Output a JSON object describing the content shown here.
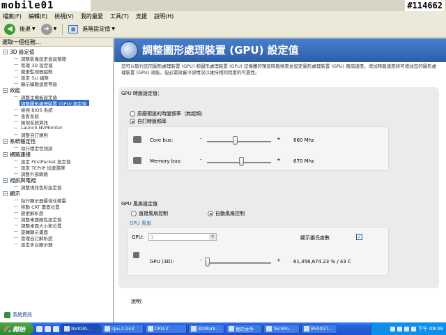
{
  "watermark": {
    "logo": "mobile01",
    "id": "#114662"
  },
  "menu": [
    "檔案(F)",
    "編輯(E)",
    "檢視(V)",
    "我的最愛",
    "工具(T)",
    "支援",
    "說明(H)"
  ],
  "toolbar": {
    "back_label": "後退",
    "forward_glyph": "➔",
    "advanced_label": "進階設定值"
  },
  "left": {
    "header": "選取一個任務...",
    "categories": [
      {
        "label": "3D 設定值",
        "items": [
          "調整影像設定值與預覽",
          "管理 3D 設定值",
          "變更監視器組態",
          "設定 SLI 組態",
          "顯示驅動速度等級"
        ]
      },
      {
        "label": "效能",
        "items": [
          "調整主機板設定值",
          "調整圖形處理裝置 (GPU) 設定值",
          "檢視 BIOS 系統",
          "查看系統",
          "檢視系統資訊",
          "Launch NVMonitor",
          "調整自訂規則"
        ]
      },
      {
        "label": "系統穩定性",
        "items": [
          "執行穩定性測試"
        ]
      },
      {
        "label": "網路連接",
        "items": [
          "設定 FirstPacket 設定值",
          "設定 TCP/IP 加速選擇",
          "調整外部網路"
        ]
      },
      {
        "label": "視訊與電視",
        "items": [
          "調整視訊色彩設定值"
        ]
      },
      {
        "label": "顯示",
        "items": [
          "執行顯示器最佳化精靈",
          "移動 CRT 畫面位置",
          "變更解析度",
          "調整桌面顏色設定值",
          "調整桌面大小和位置",
          "旋轉顯示畫面",
          "管理自訂解析度",
          "設定多台顯示器"
        ]
      }
    ],
    "selected_item": "調整圖形處理裝置 (GPU) 設定值",
    "sysinfo": "系統資訊"
  },
  "main": {
    "title": "調整圖形處理裝置 (GPU) 設定值",
    "description": "您可以取代您的圖形處理裝置 (GPU) 和圖形處理裝置 (GPU) 記憶體的預設時脈頻率並設定圖形處理裝置 (GPU) 風扇速度。增加時脈速度將可增加您的圖形處理裝置 (GPU) 效能，但必需效審冷卻情況以維持相同程度的可靠性。",
    "clock_section": "GPU 時脈設定值：",
    "clock_options": [
      "原廠預設的時脈頻率（無超頻）",
      "自訂時脈頻率"
    ],
    "clock_selected": 1,
    "core_bus": {
      "label": "Core bus:",
      "minus": "-",
      "plus": "+",
      "value": "660 Mhz",
      "level": 0.44
    },
    "memory_bus": {
      "label": "Memory bus:",
      "minus": "-",
      "plus": "+",
      "value": "670 Mhz",
      "level": 0.53
    },
    "fan_section": "GPU 風扇設定值",
    "fan_options": [
      "直接風扇控制",
      "自動風扇控制"
    ],
    "fan_selected": 1,
    "fan_group": "GPU 風扇",
    "gpu_label": "GPU:",
    "gpu_value": "1",
    "show_celsius": "顯示攝氏度數",
    "show_celsius_checked": true,
    "gpu_3d": {
      "label": "GPU (3D):",
      "minus": "-",
      "plus": "+",
      "value": "61,356,674.23 % / 43 C",
      "level": 0.0
    },
    "notes_label": "說明："
  },
  "taskbar": {
    "start": "開始",
    "buttons": [
      "NVIDIA...",
      "cpu-z-143",
      "CPU-Z",
      "3DMark...",
      "我的文件",
      "TechPo...",
      "8500GT..."
    ],
    "active": 0,
    "time": "下午 09:08"
  }
}
